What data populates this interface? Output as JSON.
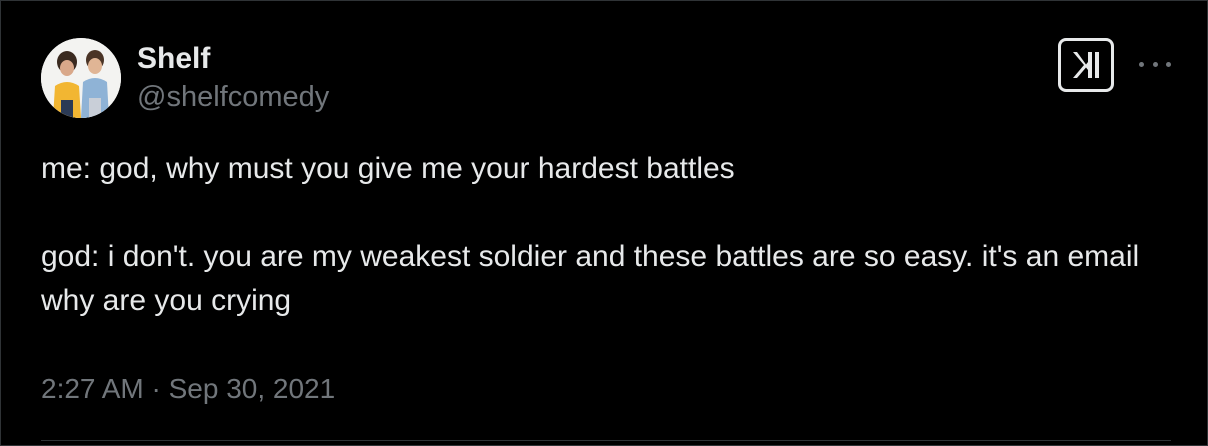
{
  "author": {
    "display_name": "Shelf",
    "handle": "@shelfcomedy",
    "avatar_icon": "profile-photo-two-people"
  },
  "header": {
    "logo_icon": "x-logo-icon",
    "more_icon": "more-options-icon"
  },
  "tweet": {
    "paragraphs": [
      "me: god, why must you give me your hardest battles",
      "god: i don't. you are my weakest soldier and these battles are so easy. it's an email why are you crying"
    ],
    "timestamp": "2:27 AM · Sep 30, 2021"
  },
  "colors": {
    "background": "#000000",
    "primary_text": "#e7e9ea",
    "secondary_text": "#71767b",
    "border": "#2f3336"
  }
}
